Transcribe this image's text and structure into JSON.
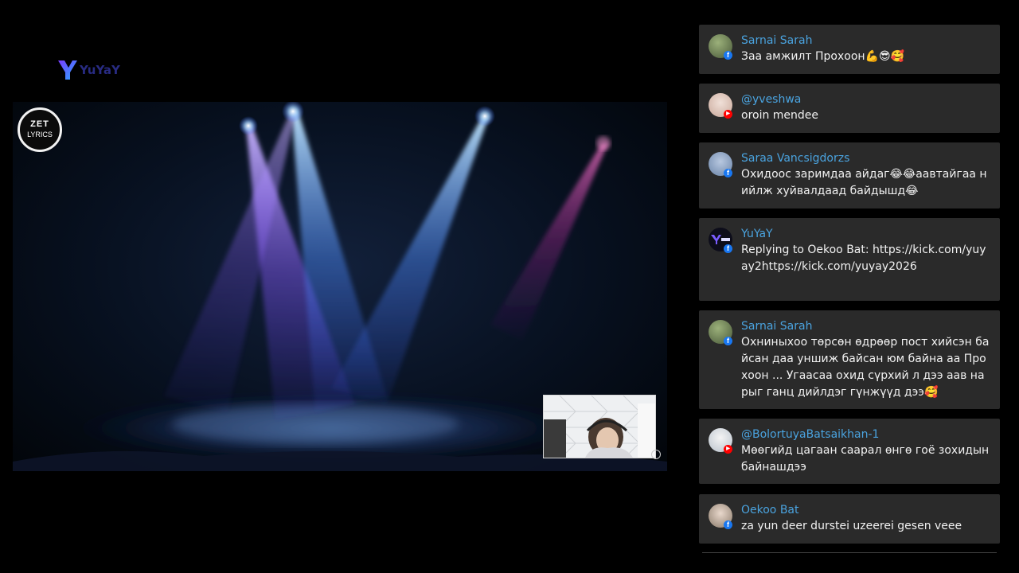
{
  "logo": {
    "text": "YuYaY"
  },
  "video": {
    "watermark_line1": "ZET",
    "watermark_line2": "LYRICS"
  },
  "chat": {
    "messages": [
      {
        "author": "Sarnai Sarah",
        "platform": "facebook",
        "text": "Заа амжилт Прохоон💪😎🥰"
      },
      {
        "author": "@yveshwa",
        "platform": "youtube",
        "text": "oroin mendee"
      },
      {
        "author": "Saraa Vancsigdorzs",
        "platform": "facebook",
        "text": "Охидоос заримдаа айдаг😂😂аавтайгаа нийлж хуйвалдаад байдышд😂"
      },
      {
        "author": "YuYaY",
        "platform": "facebook",
        "text_prefix": "Replying to Oekoo Bat: https://kick.com/yuyay2",
        "link": "https://kick.com/yuyay2026"
      },
      {
        "author": "Sarnai Sarah",
        "platform": "facebook",
        "text": "Охниныхоо төрсөн өдрөөр пост хийсэн байсан даа уншиж байсан юм байна аа Прохоон ... Угаасаа охид сүрхий л дээ аав нарыг ганц дийлдэг гүнжүүд дээ🥰"
      },
      {
        "author": "@BolortuyaBatsaikhan-1",
        "platform": "youtube",
        "text": "Мөөгийд цагаан саарал өнгө гоё зохидын байнашдээ"
      },
      {
        "author": "Oekoo Bat",
        "platform": "facebook",
        "text": "za yun deer durstei uzeerei gesen veee"
      }
    ]
  },
  "colors": {
    "background": "#000000",
    "chat_card": "#2a2a2a",
    "author_name": "#4aa3df",
    "facebook": "#1877f2",
    "youtube": "#ff0000"
  },
  "icons": [
    "yuyay-logo-icon",
    "facebook-badge-icon",
    "youtube-badge-icon",
    "camera-indicator-icon"
  ]
}
